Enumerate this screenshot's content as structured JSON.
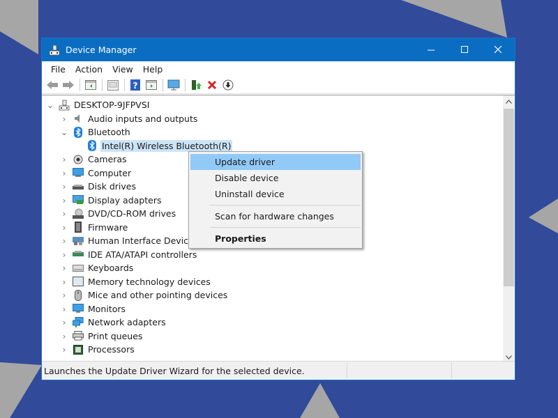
{
  "colors": {
    "background": "#314a9a",
    "background_shapes": "#a6a6a6",
    "titlebar": "#0b6dc2",
    "selection": "#cce4f7",
    "menu_highlight": "#91c9f7"
  },
  "window": {
    "title": "Device Manager",
    "app_icon": "device-manager-icon",
    "controls": {
      "minimize": "–",
      "maximize": "☐",
      "close": "✕"
    }
  },
  "menubar": {
    "items": [
      "File",
      "Action",
      "View",
      "Help"
    ]
  },
  "toolbar": {
    "buttons": [
      "back-icon",
      "forward-icon",
      "show-hide-console-tree-icon",
      "properties-icon",
      "help-icon",
      "action-pane-icon",
      "scan-hardware-icon",
      "update-driver-icon",
      "uninstall-icon",
      "disable-icon"
    ]
  },
  "tree": {
    "root": {
      "label": "DESKTOP-9JFPVSI",
      "expanded": true
    },
    "nodes": [
      {
        "label": "Audio inputs and outputs",
        "icon": "speaker-icon",
        "expanded": false
      },
      {
        "label": "Bluetooth",
        "icon": "bluetooth-icon",
        "expanded": true,
        "children": [
          {
            "label": "Intel(R) Wireless Bluetooth(R)",
            "icon": "bluetooth-icon",
            "selected": true
          }
        ]
      },
      {
        "label": "Cameras",
        "icon": "camera-icon",
        "expanded": false
      },
      {
        "label": "Computer",
        "icon": "computer-icon",
        "expanded": false
      },
      {
        "label": "Disk drives",
        "icon": "disk-drive-icon",
        "expanded": false
      },
      {
        "label": "Display adapters",
        "icon": "display-adapter-icon",
        "expanded": false
      },
      {
        "label": "DVD/CD-ROM drives",
        "icon": "dvd-drive-icon",
        "expanded": false
      },
      {
        "label": "Firmware",
        "icon": "firmware-icon",
        "expanded": false
      },
      {
        "label": "Human Interface Devices",
        "icon": "hid-icon",
        "expanded": false
      },
      {
        "label": "IDE ATA/ATAPI controllers",
        "icon": "ide-controller-icon",
        "expanded": false
      },
      {
        "label": "Keyboards",
        "icon": "keyboard-icon",
        "expanded": false
      },
      {
        "label": "Memory technology devices",
        "icon": "memory-icon",
        "expanded": false
      },
      {
        "label": "Mice and other pointing devices",
        "icon": "mouse-icon",
        "expanded": false
      },
      {
        "label": "Monitors",
        "icon": "monitor-icon",
        "expanded": false
      },
      {
        "label": "Network adapters",
        "icon": "network-adapter-icon",
        "expanded": false
      },
      {
        "label": "Print queues",
        "icon": "printer-icon",
        "expanded": false
      },
      {
        "label": "Processors",
        "icon": "processor-icon",
        "expanded": false
      }
    ]
  },
  "context_menu": {
    "items": [
      {
        "label": "Update driver",
        "highlighted": true
      },
      {
        "label": "Disable device"
      },
      {
        "label": "Uninstall device"
      },
      {
        "separator": true
      },
      {
        "label": "Scan for hardware changes"
      },
      {
        "separator": true
      },
      {
        "label": "Properties",
        "bold": true
      }
    ]
  },
  "statusbar": {
    "text": "Launches the Update Driver Wizard for the selected device."
  }
}
